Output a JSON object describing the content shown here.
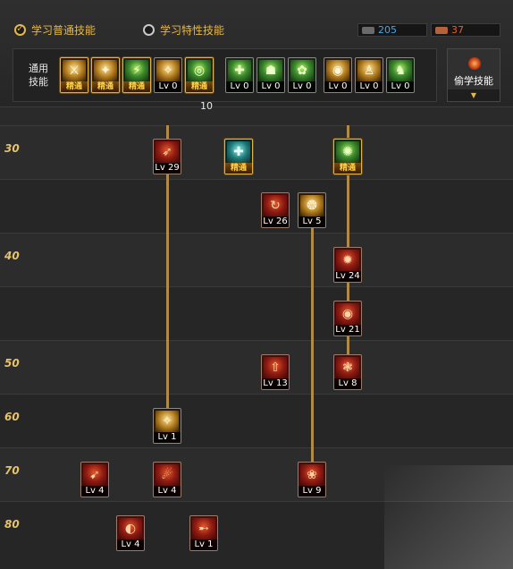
{
  "tabs": {
    "normal": "学习普通技能",
    "special": "学习特性技能",
    "check_mark": "✓"
  },
  "sp": {
    "blue_value": "205",
    "red_value": "37"
  },
  "common": {
    "label_line1": "通用",
    "label_line2": "技能",
    "sub_value": "10",
    "skills": [
      {
        "name": "common-skill-1",
        "color": "amber",
        "glyph": "⚔",
        "badge": "精通"
      },
      {
        "name": "common-skill-2",
        "color": "amber",
        "glyph": "✦",
        "badge": "精通"
      },
      {
        "name": "common-skill-3",
        "color": "green",
        "glyph": "⚡",
        "badge": "精通"
      },
      {
        "name": "common-skill-4",
        "color": "amber",
        "glyph": "✧",
        "level": "Lv 0"
      },
      {
        "name": "common-skill-5",
        "color": "green",
        "glyph": "◎",
        "badge": "精通"
      },
      {
        "name": "common-skill-6",
        "color": "green",
        "glyph": "✚",
        "level": "Lv 0"
      },
      {
        "name": "common-skill-7",
        "color": "green",
        "glyph": "☗",
        "level": "Lv 0"
      },
      {
        "name": "common-skill-8",
        "color": "green",
        "glyph": "✿",
        "level": "Lv 0"
      },
      {
        "name": "common-skill-9",
        "color": "amber",
        "glyph": "◉",
        "level": "Lv 0"
      },
      {
        "name": "common-skill-10",
        "color": "amber",
        "glyph": "♙",
        "level": "Lv 0"
      },
      {
        "name": "common-skill-11",
        "color": "green",
        "glyph": "♞",
        "level": "Lv 0"
      }
    ]
  },
  "steal_button": {
    "label": "偷学技能",
    "arrow": "▼"
  },
  "tree": {
    "levels": [
      "30",
      "40",
      "50",
      "60",
      "70",
      "80"
    ],
    "skills": [
      {
        "name": "skill-l30-a",
        "color": "red",
        "glyph": "➶",
        "level": "Lv 29"
      },
      {
        "name": "skill-l30-b",
        "color": "teal",
        "glyph": "✚",
        "badge": "精通"
      },
      {
        "name": "skill-l30-c",
        "color": "green",
        "glyph": "✺",
        "badge": "精通"
      },
      {
        "name": "skill-l35-a",
        "color": "red",
        "glyph": "↻",
        "level": "Lv 26"
      },
      {
        "name": "skill-l35-b",
        "color": "amber",
        "glyph": "❂",
        "level": "Lv 5"
      },
      {
        "name": "skill-l40-a",
        "color": "red",
        "glyph": "✹",
        "level": "Lv 24"
      },
      {
        "name": "skill-l45-a",
        "color": "red",
        "glyph": "◉",
        "level": "Lv 21"
      },
      {
        "name": "skill-l50-a",
        "color": "red",
        "glyph": "⇧",
        "level": "Lv 13"
      },
      {
        "name": "skill-l50-b",
        "color": "red",
        "glyph": "❃",
        "level": "Lv 8"
      },
      {
        "name": "skill-l60-a",
        "color": "amber",
        "glyph": "✧",
        "level": "Lv 1"
      },
      {
        "name": "skill-l70-a",
        "color": "red",
        "glyph": "➹",
        "level": "Lv 4"
      },
      {
        "name": "skill-l70-b",
        "color": "red",
        "glyph": "☄",
        "level": "Lv 4"
      },
      {
        "name": "skill-l70-c",
        "color": "red",
        "glyph": "❀",
        "level": "Lv 9"
      },
      {
        "name": "skill-l80-a",
        "color": "red",
        "glyph": "◐",
        "level": "Lv 4"
      },
      {
        "name": "skill-l80-b",
        "color": "red",
        "glyph": "➸",
        "level": "Lv 1"
      }
    ]
  },
  "colors": {
    "accent_gold": "#e4b84a",
    "line_gold": "#b18a46",
    "sp_blue": "#4fa3e0",
    "sp_red": "#e06038"
  }
}
